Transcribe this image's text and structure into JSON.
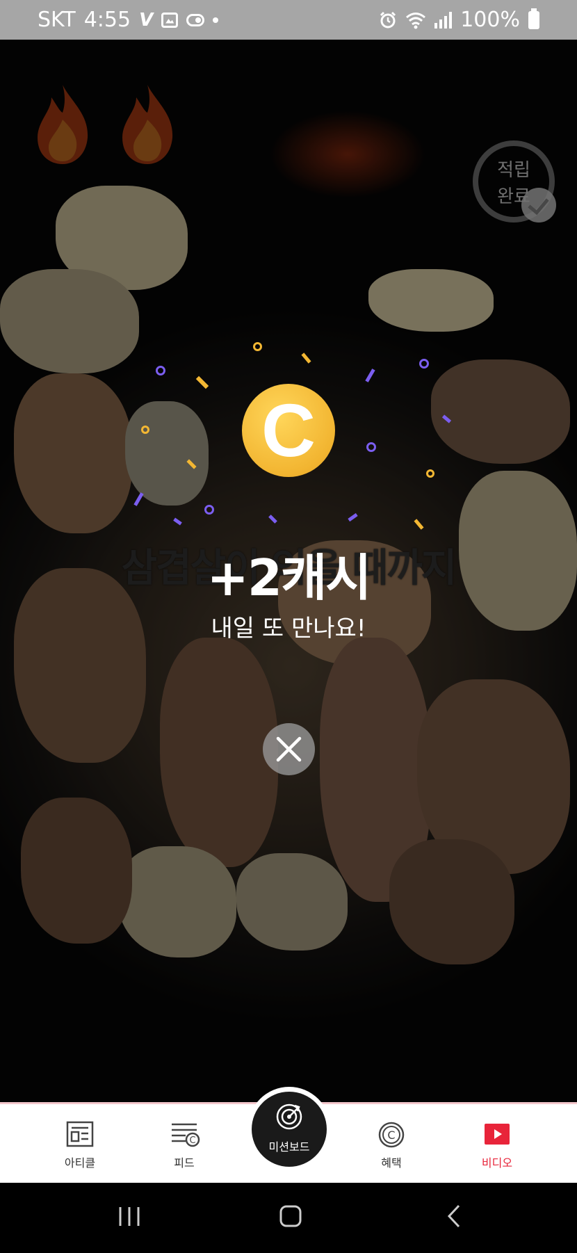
{
  "status_bar": {
    "carrier": "SKT",
    "time": "4:55",
    "battery": "100%",
    "left_icons": [
      "v-app-icon",
      "gallery-icon",
      "toggle-icon",
      "dot-icon"
    ],
    "right_icons": [
      "alarm-icon",
      "wifi-icon",
      "signal-icon",
      "battery-icon"
    ]
  },
  "video": {
    "caption": "삼겹살이 익을 때까지",
    "badge_text": "적립\n완료"
  },
  "reward": {
    "amount": "+2캐시",
    "message": "내일 또 만나요!",
    "coin_letter": "C"
  },
  "bottom_nav": {
    "items": [
      {
        "label": "아티클",
        "icon": "article-icon"
      },
      {
        "label": "피드",
        "icon": "feed-icon"
      },
      {
        "label": "미션보드",
        "icon": "target-icon"
      },
      {
        "label": "혜택",
        "icon": "cash-coin-icon"
      },
      {
        "label": "비디오",
        "icon": "video-play-icon"
      }
    ],
    "active": "비디오",
    "active_color": "#e8243a"
  },
  "colors": {
    "coin": "#f2b531",
    "confetti_purple": "#7b5ef0",
    "confetti_yellow": "#f3b733"
  }
}
